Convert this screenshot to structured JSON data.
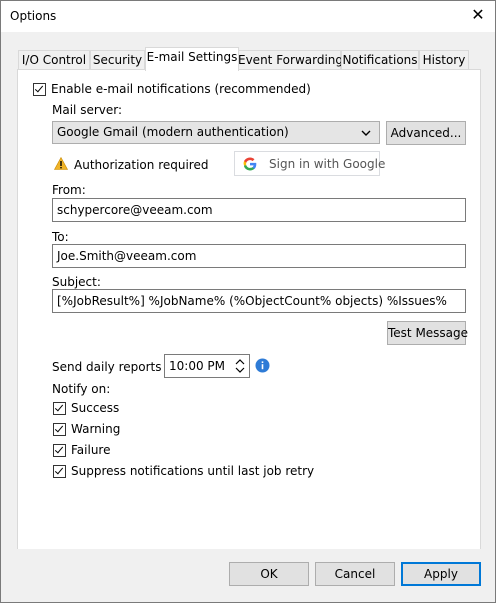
{
  "window": {
    "title": "Options",
    "close_glyph": "✕"
  },
  "tabs": [
    {
      "label": "I/O Control"
    },
    {
      "label": "Security"
    },
    {
      "label": "E-mail Settings",
      "active": true
    },
    {
      "label": "Event Forwarding"
    },
    {
      "label": "Notifications"
    },
    {
      "label": "History"
    }
  ],
  "email": {
    "enable_label": "Enable e-mail notifications (recommended)",
    "enable_checked": true,
    "mail_server_label": "Mail server:",
    "mail_server_value": "Google Gmail (modern authentication)",
    "advanced_button": "Advanced...",
    "auth_warning": "Authorization required",
    "signin_button": "Sign in with Google",
    "from_label": "From:",
    "from_value": "schypercore@veeam.com",
    "to_label": "To:",
    "to_value": "Joe.Smith@veeam.com",
    "subject_label": "Subject:",
    "subject_value": "[%JobResult%] %JobName% (%ObjectCount% objects) %Issues%",
    "test_button": "Test Message",
    "daily_label": "Send daily reports at:",
    "daily_time": "10:00 PM",
    "notify_label": "Notify on:",
    "notify_items": [
      {
        "label": "Success",
        "checked": true
      },
      {
        "label": "Warning",
        "checked": true
      },
      {
        "label": "Failure",
        "checked": true
      },
      {
        "label": "Suppress notifications until last job retry",
        "checked": true
      }
    ]
  },
  "footer": {
    "ok": "OK",
    "cancel": "Cancel",
    "apply": "Apply"
  },
  "colors": {
    "accent": "#0078d7",
    "info": "#2e7bd6",
    "warning": "#f0b429"
  },
  "icons": {
    "warning": "warning-icon",
    "info": "info-icon",
    "google": "google-logo-icon",
    "dropdown": "chevron-down-icon",
    "spin": "spin-updown-icon"
  }
}
